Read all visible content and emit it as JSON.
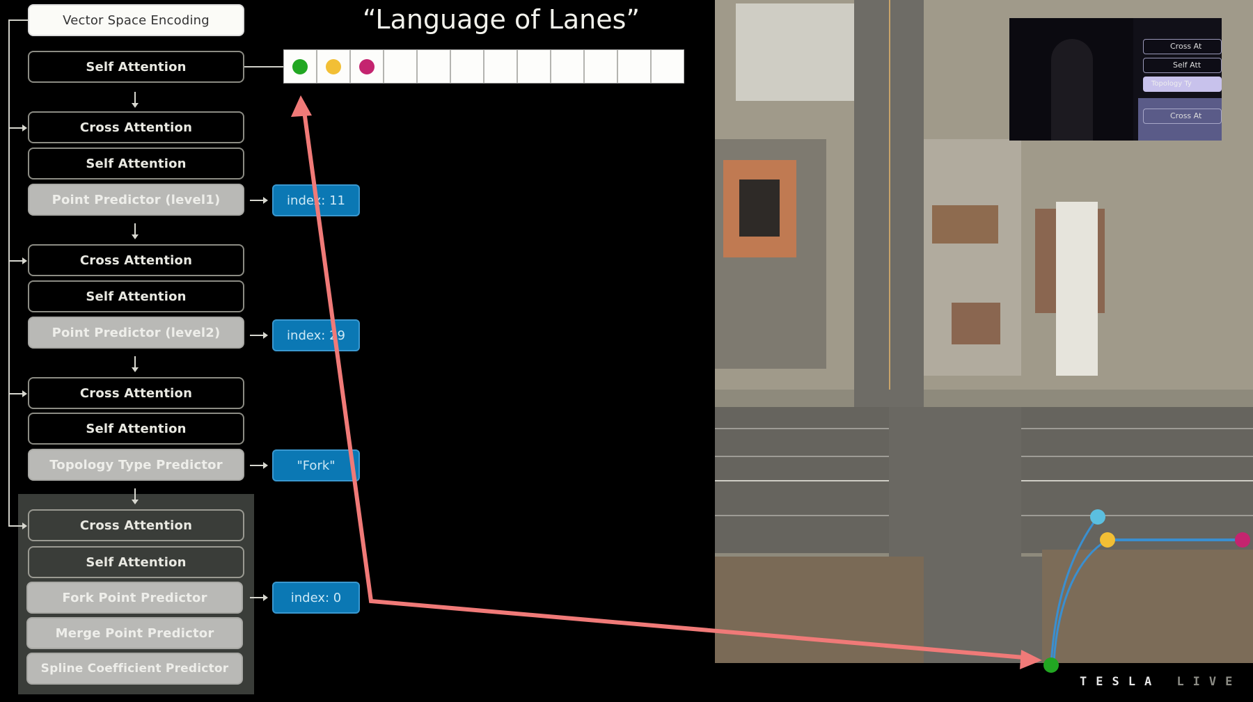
{
  "slide": {
    "title": "“Language of Lanes”",
    "branding": {
      "brand": "TESLA",
      "suffix": "LIVE"
    }
  },
  "pipeline": {
    "input_block": "Vector Space Encoding",
    "blocks": [
      {
        "label": "Self Attention",
        "type": "attention"
      },
      {
        "label": "Cross Attention",
        "type": "attention"
      },
      {
        "label": "Self Attention",
        "type": "attention"
      },
      {
        "label": "Point Predictor (level1)",
        "type": "predictor",
        "output": "index: 11"
      },
      {
        "label": "Cross Attention",
        "type": "attention"
      },
      {
        "label": "Self Attention",
        "type": "attention"
      },
      {
        "label": "Point Predictor (level2)",
        "type": "predictor",
        "output": "index: 29"
      },
      {
        "label": "Cross Attention",
        "type": "attention"
      },
      {
        "label": "Self Attention",
        "type": "attention"
      },
      {
        "label": "Topology Type Predictor",
        "type": "predictor",
        "output": "\"Fork\""
      },
      {
        "label": "Cross Attention",
        "type": "attention",
        "group": "active"
      },
      {
        "label": "Self Attention",
        "type": "attention",
        "group": "active"
      },
      {
        "label": "Fork Point Predictor",
        "type": "predictor",
        "group": "active",
        "output": "index: 0"
      },
      {
        "label": "Merge Point Predictor",
        "type": "predictor",
        "group": "active"
      },
      {
        "label": "Spline Coefficient Predictor",
        "type": "predictor",
        "group": "active"
      }
    ]
  },
  "token_sequence": {
    "cell_count": 12,
    "filled": [
      {
        "color_name": "green",
        "color": "#22a722"
      },
      {
        "color_name": "yellow",
        "color": "#f2bf35"
      },
      {
        "color_name": "magenta",
        "color": "#c4246f"
      }
    ]
  },
  "map_overlay": {
    "nodes": [
      {
        "name": "green",
        "color": "#22a722"
      },
      {
        "name": "cyan",
        "color": "#5bbfe0"
      },
      {
        "name": "yellow",
        "color": "#f2bf35"
      },
      {
        "name": "magenta",
        "color": "#c4246f"
      }
    ],
    "edge_color": "#3a8fd0",
    "annotation_arrow_color": "#f07a78"
  },
  "inset": {
    "visible_labels": [
      "Cross At",
      "Self Att",
      "Topology Ty",
      "Cross At"
    ]
  },
  "colors": {
    "output_box": "#0b78b4",
    "predictor_box": "#b9b9b6",
    "active_panel": "#3a3d39"
  }
}
